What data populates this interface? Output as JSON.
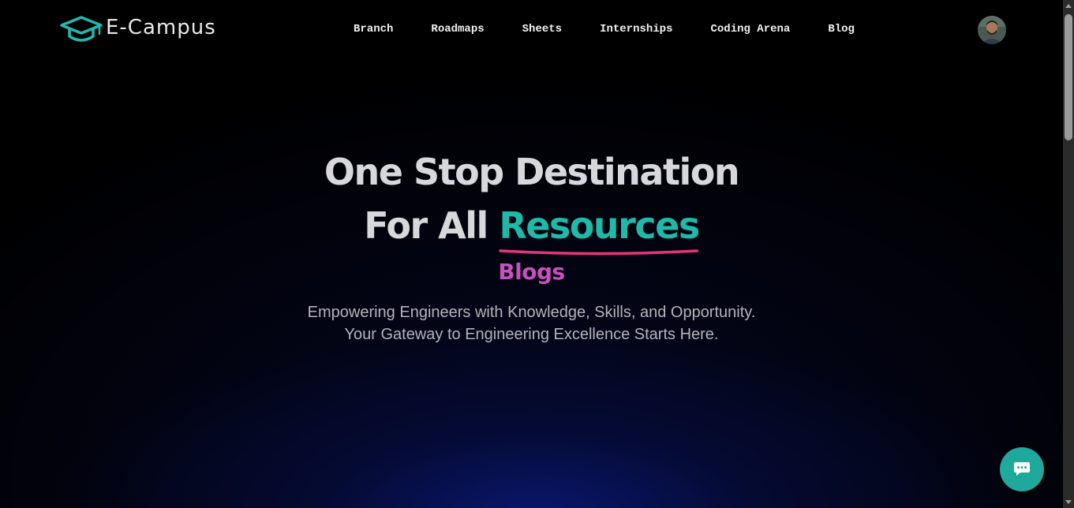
{
  "brand": {
    "name": "E-Campus",
    "logo_icon": "graduation-cap-icon",
    "accent_color": "#1fb9a8"
  },
  "nav": {
    "items": [
      {
        "label": "Branch"
      },
      {
        "label": "Roadmaps"
      },
      {
        "label": "Sheets"
      },
      {
        "label": "Internships"
      },
      {
        "label": "Coding Arena"
      },
      {
        "label": "Blog"
      }
    ]
  },
  "user": {
    "avatar_icon": "user-avatar"
  },
  "hero": {
    "line1": "One Stop Destination",
    "line2_prefix": "For All",
    "line2_highlight": "Resources",
    "rotating_word": "Blogs",
    "description_line1": "Empowering Engineers with Knowledge, Skills, and Opportunity.",
    "description_line2": "Your Gateway to Engineering Excellence Starts Here.",
    "highlight_color": "#1fb9a8",
    "underline_color": "#e5357a",
    "rotating_color": "#c850bd"
  },
  "chat": {
    "icon": "chat-bubble-icon",
    "color": "#1fa99c"
  }
}
